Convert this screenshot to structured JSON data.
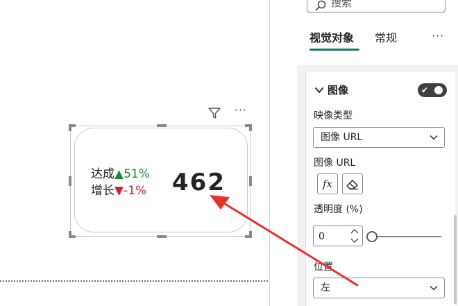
{
  "canvas": {
    "kpi": {
      "line1_label": "达成",
      "line1_arrow": "▲",
      "line1_value": "51%",
      "line2_label": "增长",
      "line2_arrow": "▼",
      "line2_value": "-1%",
      "main_value": "462"
    },
    "header_icons": [
      "filter-icon",
      "more-options-icon"
    ],
    "more_glyph": "···",
    "colors": {
      "up": "#1e8a2f",
      "down": "#d4222a",
      "annotation_arrow": "#e8322c"
    }
  },
  "pane": {
    "search_placeholder": "搜索",
    "tabs": [
      {
        "label": "视觉对象",
        "selected": true
      },
      {
        "label": "常规",
        "selected": false
      }
    ],
    "more_glyph": "···",
    "accent": "#117865",
    "section": {
      "title": "图像",
      "toggle_on": true,
      "toggle_check": "✔",
      "image_type_label": "映像类型",
      "image_type_value": "图像 URL",
      "image_url_label": "图像 URL",
      "fx_label": "fx",
      "transparency_label": "透明度 (%)",
      "transparency_value": "0",
      "position_label": "位置",
      "position_value": "左"
    }
  }
}
